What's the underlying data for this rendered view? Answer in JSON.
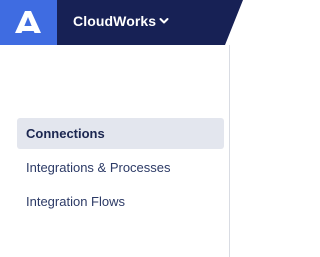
{
  "header": {
    "logo_icon": "app-launcher-a-logo-icon",
    "app_name": "CloudWorks",
    "app_switcher_icon": "chevron-down-icon",
    "colors": {
      "logo_background": "#3f6ce1",
      "app_background": "#172155",
      "app_text": "#ffffff"
    }
  },
  "sidebar": {
    "items": [
      {
        "label": "Connections",
        "active": true
      },
      {
        "label": "Integrations & Processes",
        "active": false
      },
      {
        "label": "Integration Flows",
        "active": false
      }
    ],
    "colors": {
      "active_background": "#e3e6ee",
      "text": "#2c3a66"
    }
  }
}
